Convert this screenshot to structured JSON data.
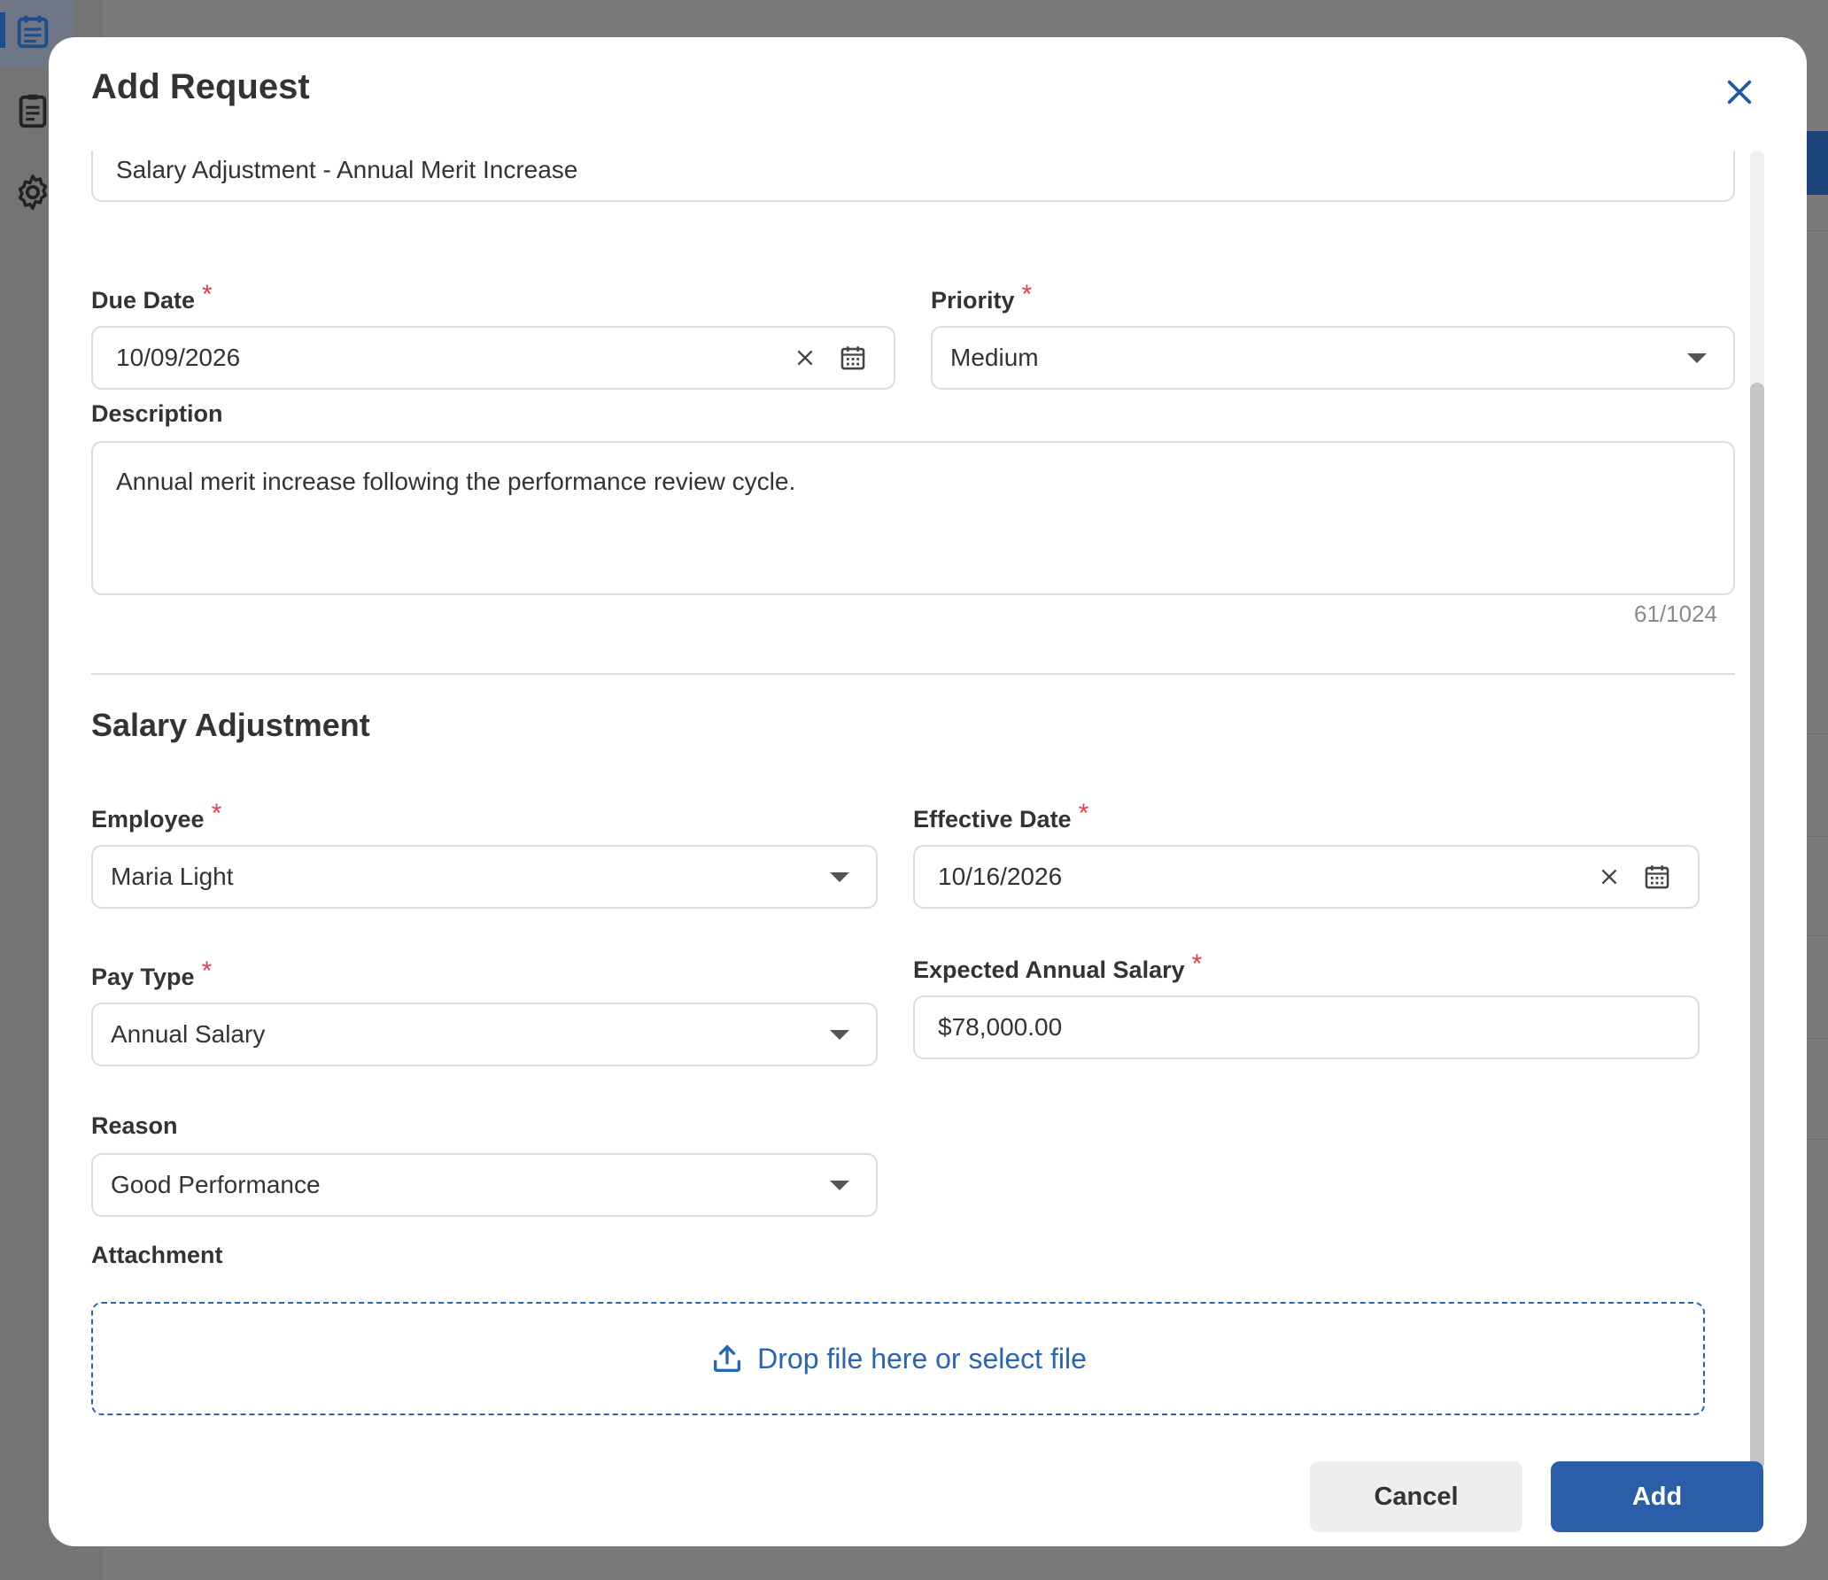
{
  "modal": {
    "title": "Add Request"
  },
  "form": {
    "subject_value": "Salary Adjustment - Annual Merit Increase",
    "due_date": {
      "label": "Due Date",
      "required": "*",
      "value": "10/09/2026"
    },
    "priority": {
      "label": "Priority",
      "required": "*",
      "value": "Medium"
    },
    "description": {
      "label": "Description",
      "value": "Annual merit increase following the performance review cycle.",
      "counter": "61/1024"
    }
  },
  "salary_adjustment": {
    "section_title": "Salary Adjustment",
    "employee": {
      "label": "Employee",
      "required": "*",
      "value": "Maria Light"
    },
    "effective_date": {
      "label": "Effective Date",
      "required": "*",
      "value": "10/16/2026"
    },
    "pay_type": {
      "label": "Pay Type",
      "required": "*",
      "value": "Annual Salary"
    },
    "expected_salary": {
      "label": "Expected Annual Salary",
      "required": "*",
      "value": "$78,000.00"
    },
    "reason": {
      "label": "Reason",
      "value": "Good Performance"
    },
    "attachment": {
      "label": "Attachment",
      "dropzone_text": "Drop file here or select file"
    }
  },
  "actions": {
    "cancel_label": "Cancel",
    "add_label": "Add"
  },
  "colors": {
    "primary": "#2a5ea8",
    "link": "#2a64b4",
    "required": "#e0414f",
    "close": "#1e5aa0"
  },
  "icons": [
    "calendar-icon",
    "clipboard-icon",
    "gear-icon",
    "close-icon",
    "clear-icon",
    "chevron-down-icon",
    "upload-icon"
  ]
}
